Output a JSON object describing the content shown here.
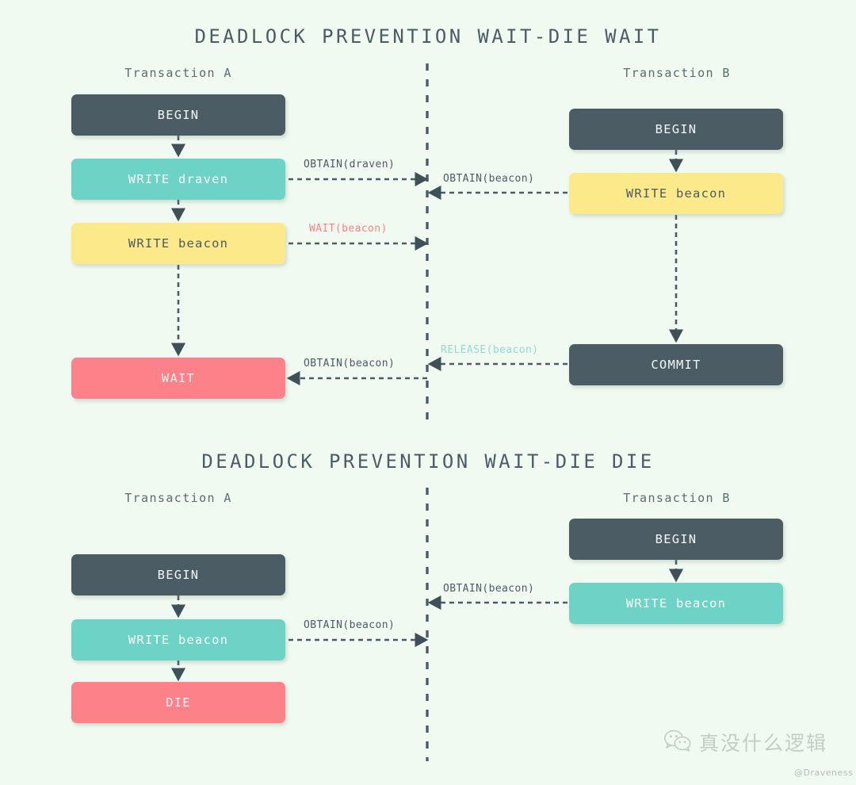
{
  "background_color": "#f0faf0",
  "palette": {
    "dark": "#4b5c64",
    "teal": "#6ed3c7",
    "amber": "#fce98a",
    "pink": "#fc8189",
    "text_dark": "#4b5c64",
    "wait_label": "#fc8189",
    "release_label": "#8fdcd2"
  },
  "diagrams": [
    {
      "title": "DEADLOCK PREVENTION WAIT-DIE WAIT",
      "columns": [
        {
          "label": "Transaction A"
        },
        {
          "label": "Transaction B"
        }
      ],
      "nodes": [
        {
          "id": "a1",
          "label": "BEGIN",
          "color": "dark"
        },
        {
          "id": "a2",
          "label": "WRITE draven",
          "color": "teal"
        },
        {
          "id": "a3",
          "label": "WRITE beacon",
          "color": "amber"
        },
        {
          "id": "a4",
          "label": "WAIT",
          "color": "pink"
        },
        {
          "id": "b1",
          "label": "BEGIN",
          "color": "dark"
        },
        {
          "id": "b2",
          "label": "WRITE beacon",
          "color": "amber"
        },
        {
          "id": "b3",
          "label": "COMMIT",
          "color": "dark"
        }
      ],
      "edge_labels": [
        {
          "id": "e1",
          "text": "OBTAIN(draven)",
          "style": "normal"
        },
        {
          "id": "e2",
          "text": "OBTAIN(beacon)",
          "style": "normal"
        },
        {
          "id": "e3",
          "text": "WAIT(beacon)",
          "style": "wait"
        },
        {
          "id": "e4",
          "text": "OBTAIN(beacon)",
          "style": "normal"
        },
        {
          "id": "e5",
          "text": "RELEASE(beacon)",
          "style": "release"
        }
      ]
    },
    {
      "title": "DEADLOCK PREVENTION WAIT-DIE DIE",
      "columns": [
        {
          "label": "Transaction A"
        },
        {
          "label": "Transaction B"
        }
      ],
      "nodes": [
        {
          "id": "c1",
          "label": "BEGIN",
          "color": "dark"
        },
        {
          "id": "c2",
          "label": "WRITE beacon",
          "color": "teal"
        },
        {
          "id": "c3",
          "label": "DIE",
          "color": "pink"
        },
        {
          "id": "d1",
          "label": "BEGIN",
          "color": "dark"
        },
        {
          "id": "d2",
          "label": "WRITE beacon",
          "color": "teal"
        }
      ],
      "edge_labels": [
        {
          "id": "f1",
          "text": "OBTAIN(beacon)",
          "style": "normal"
        },
        {
          "id": "f2",
          "text": "OBTAIN(beacon)",
          "style": "normal"
        }
      ]
    }
  ],
  "watermark": {
    "icon": "wechat-icon",
    "text": "真没什么逻辑",
    "handle": "@Draveness"
  }
}
